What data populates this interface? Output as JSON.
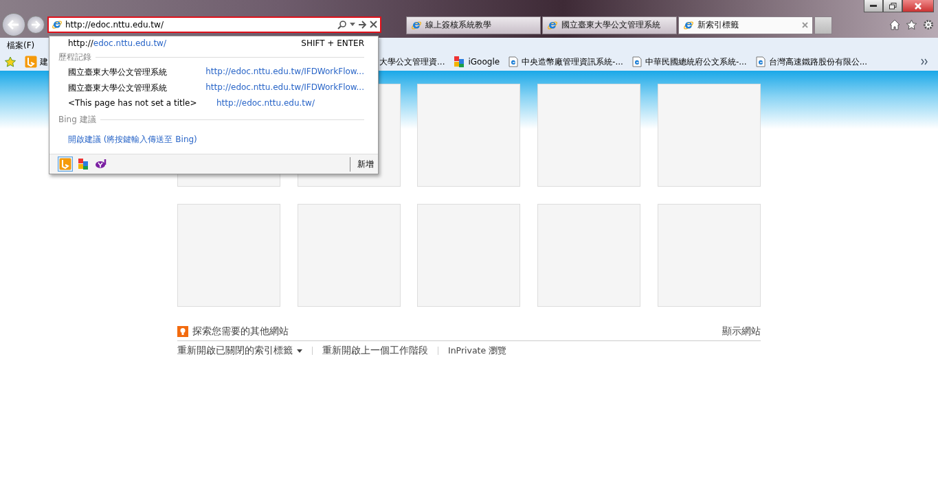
{
  "address_bar": {
    "value": "http://edoc.nttu.edu.tw/"
  },
  "tabs": [
    {
      "label": "線上簽核系統教學",
      "selected": false
    },
    {
      "label": "國立臺東大學公文管理系統",
      "selected": false
    },
    {
      "label": "新索引標籤",
      "selected": true
    }
  ],
  "menu_bar": [
    "檔案(F)"
  ],
  "favorites": [
    {
      "label": "建",
      "kind": "bing"
    },
    {
      "label": "大學公文管理資...",
      "kind": "none"
    },
    {
      "label": "iGoogle",
      "kind": "google"
    },
    {
      "label": "中央造幣廠管理資訊系統-...",
      "kind": "page"
    },
    {
      "label": "中華民國總統府公文系統-...",
      "kind": "page"
    },
    {
      "label": "台灣高速鐵路股份有限公...",
      "kind": "page"
    }
  ],
  "dropdown": {
    "top_suggestion": {
      "prefix": "http://",
      "domain": "edoc.nttu.edu.tw/",
      "shortcut": "SHIFT + ENTER"
    },
    "history_heading": "歷程記錄",
    "history": [
      {
        "title": "國立臺東大學公文管理系統",
        "url": "http://edoc.nttu.edu.tw/IFDWorkFlow..."
      },
      {
        "title": "國立臺東大學公文管理系統",
        "url": "http://edoc.nttu.edu.tw/IFDWorkFlow..."
      },
      {
        "title": "<This page has not set a title>",
        "url": "http://edoc.nttu.edu.tw/"
      }
    ],
    "bing_heading": "Bing 建議",
    "bing_link": "開啟建議 (將按鍵輸入傳送至 Bing)",
    "providers": [
      {
        "kind": "bing",
        "selected": true
      },
      {
        "kind": "google",
        "selected": false
      },
      {
        "kind": "yahoo",
        "selected": false
      }
    ],
    "add_button": "新增"
  },
  "new_tab_page": {
    "tiles": [
      {
        "kind": "empty"
      },
      {
        "kind": "empty"
      },
      {
        "kind": "empty"
      },
      {
        "kind": "empty"
      },
      {
        "kind": "empty"
      },
      {
        "kind": "empty"
      },
      {
        "kind": "empty"
      },
      {
        "kind": "empty"
      },
      {
        "kind": "empty"
      },
      {
        "kind": "empty"
      }
    ],
    "discover": "探索您需要的其他網站",
    "show_sites": "顯示網站",
    "links": [
      {
        "label": "重新開啟已關閉的索引標籤",
        "dropdown": true
      },
      {
        "label": "重新開啟上一個工作階段",
        "dropdown": false
      },
      {
        "label": "InPrivate 瀏覽",
        "dropdown": false
      }
    ]
  }
}
